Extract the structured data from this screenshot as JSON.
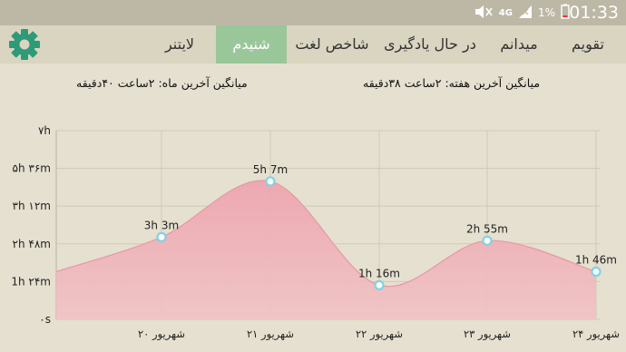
{
  "status_bar": {
    "network": "4G",
    "battery": "1%",
    "time": "01:33"
  },
  "tabs": [
    {
      "label": "تقویم",
      "active": false
    },
    {
      "label": "میدانم",
      "active": false
    },
    {
      "label": "در حال یادگیری",
      "active": false
    },
    {
      "label": "شاخص لغت",
      "active": false
    },
    {
      "label": "شنیدم",
      "active": true
    },
    {
      "label": "لایتنر",
      "active": false
    }
  ],
  "colors": {
    "accent": "#9ac79a",
    "gear": "#2e9a78",
    "area": "#f0a8b3",
    "background": "#e5e0cf"
  },
  "averages": {
    "week": "میانگین آخرین هفته: ۲ساعت  ۳۸دقیقه",
    "month": "میانگین آخرین ماه: ۲ساعت  ۴۰دقیقه"
  },
  "chart_data": {
    "type": "area",
    "categories": [
      "۲۰ شهریور",
      "۲۱ شهریور",
      "۲۲ شهریور",
      "۲۳ شهریور",
      "۲۴ شهریور"
    ],
    "values_minutes": [
      183,
      307,
      76,
      175,
      106
    ],
    "point_labels": [
      "3h 3m",
      "5h 7m",
      "1h 16m",
      "2h 55m",
      "1h 46m"
    ],
    "y_ticks_minutes": [
      0,
      84,
      168,
      252,
      336,
      420
    ],
    "y_tick_labels": [
      "۰s",
      "1h ۲۴m",
      "۲h ۴۸m",
      "۳h ۱۲m",
      "۵h ۳۶m",
      "۷h"
    ],
    "ylim": [
      0,
      420
    ],
    "grid": true
  }
}
